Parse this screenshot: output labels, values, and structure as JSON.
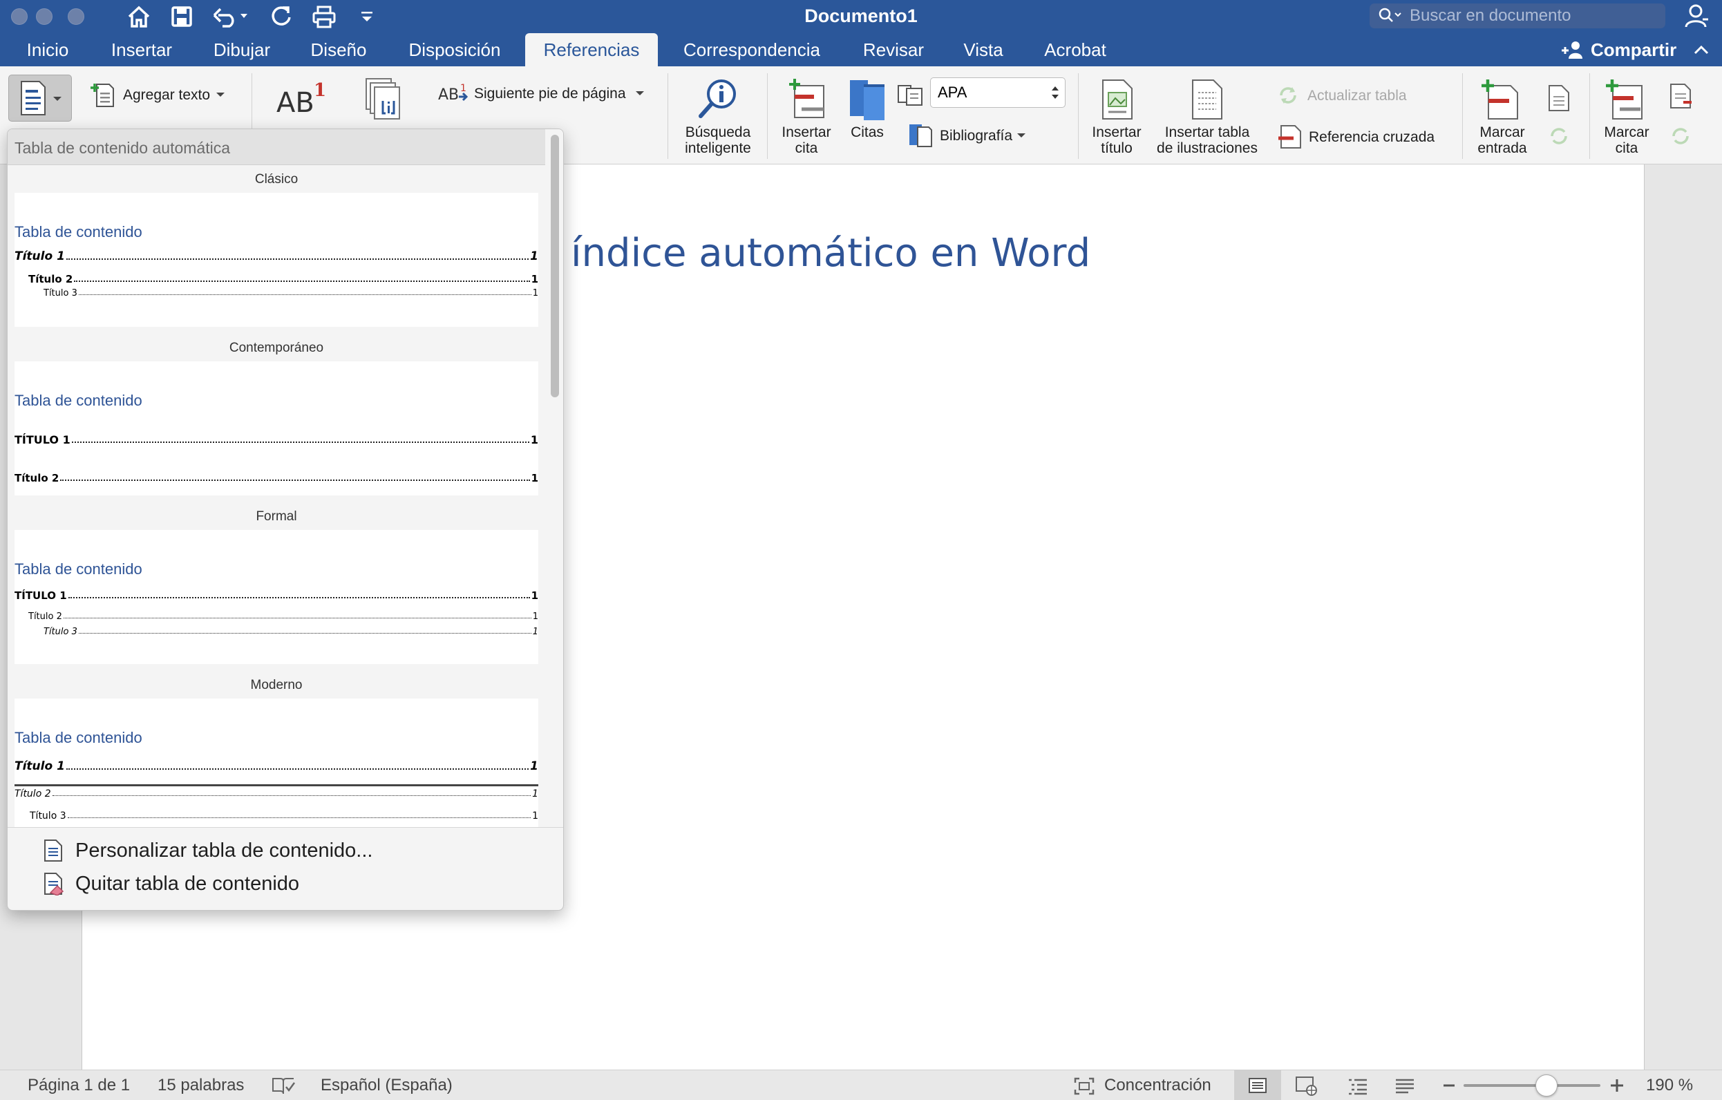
{
  "window": {
    "title": "Documento1"
  },
  "search": {
    "placeholder": "Buscar en documento"
  },
  "tabs": [
    {
      "label": "Inicio"
    },
    {
      "label": "Insertar"
    },
    {
      "label": "Dibujar"
    },
    {
      "label": "Diseño"
    },
    {
      "label": "Disposición"
    },
    {
      "label": "Referencias"
    },
    {
      "label": "Correspondencia"
    },
    {
      "label": "Revisar"
    },
    {
      "label": "Vista"
    },
    {
      "label": "Acrobat"
    }
  ],
  "active_tab": "Referencias",
  "share": {
    "label": "Compartir"
  },
  "ribbon": {
    "agregar_texto": "Agregar texto",
    "footnote_glyph": "AB",
    "footnote_sup": "1",
    "siguiente_pie": "Siguiente pie de página",
    "busqueda": [
      "Búsqueda",
      "inteligente"
    ],
    "insertar_cita": [
      "Insertar",
      "cita"
    ],
    "citas": "Citas",
    "style_value": "APA",
    "bibliografia": "Bibliografía",
    "insertar_titulo": [
      "Insertar",
      "título"
    ],
    "insertar_tabla_ilustraciones": [
      "Insertar tabla",
      "de ilustraciones"
    ],
    "actualizar_tabla": "Actualizar tabla",
    "referencia_cruzada": "Referencia cruzada",
    "marcar_entrada": [
      "Marcar",
      "entrada"
    ],
    "marcar_cita": [
      "Marcar",
      "cita"
    ]
  },
  "document": {
    "heading": "índice automático en Word"
  },
  "toc_menu": {
    "header": "Tabla de contenido automática",
    "gallery": [
      {
        "name": "Clásico",
        "heading": "Tabla de contenido",
        "entries": [
          {
            "text": "Título 1",
            "num": "1"
          },
          {
            "text": "Título 2",
            "num": "1"
          },
          {
            "text": "Título 3",
            "num": "1"
          }
        ]
      },
      {
        "name": "Contemporáneo",
        "heading": "Tabla de contenido",
        "entries": [
          {
            "text": "TÍTULO 1",
            "num": "1"
          },
          {
            "text": "Título 2",
            "num": "1"
          }
        ]
      },
      {
        "name": "Formal",
        "heading": "Tabla de contenido",
        "entries": [
          {
            "text": "TÍTULO 1",
            "num": "1"
          },
          {
            "text": "Título 2",
            "num": "1"
          },
          {
            "text": "Título 3",
            "num": "1"
          }
        ]
      },
      {
        "name": "Moderno",
        "heading": "Tabla de contenido",
        "entries": [
          {
            "text": "Título 1",
            "num": "1"
          },
          {
            "text": "Título 2",
            "num": "1"
          },
          {
            "text": "Título 3",
            "num": "1"
          }
        ]
      }
    ],
    "actions": {
      "customize": "Personalizar tabla de contenido...",
      "remove": "Quitar tabla de contenido"
    }
  },
  "status": {
    "page": "Página 1 de 1",
    "words": "15 palabras",
    "language": "Español (España)",
    "focus": "Concentración",
    "zoom": "190 %",
    "zoom_level_percent": 190
  },
  "colors": {
    "ribbon_blue": "#2b579a",
    "heading_blue": "#2f5496"
  }
}
